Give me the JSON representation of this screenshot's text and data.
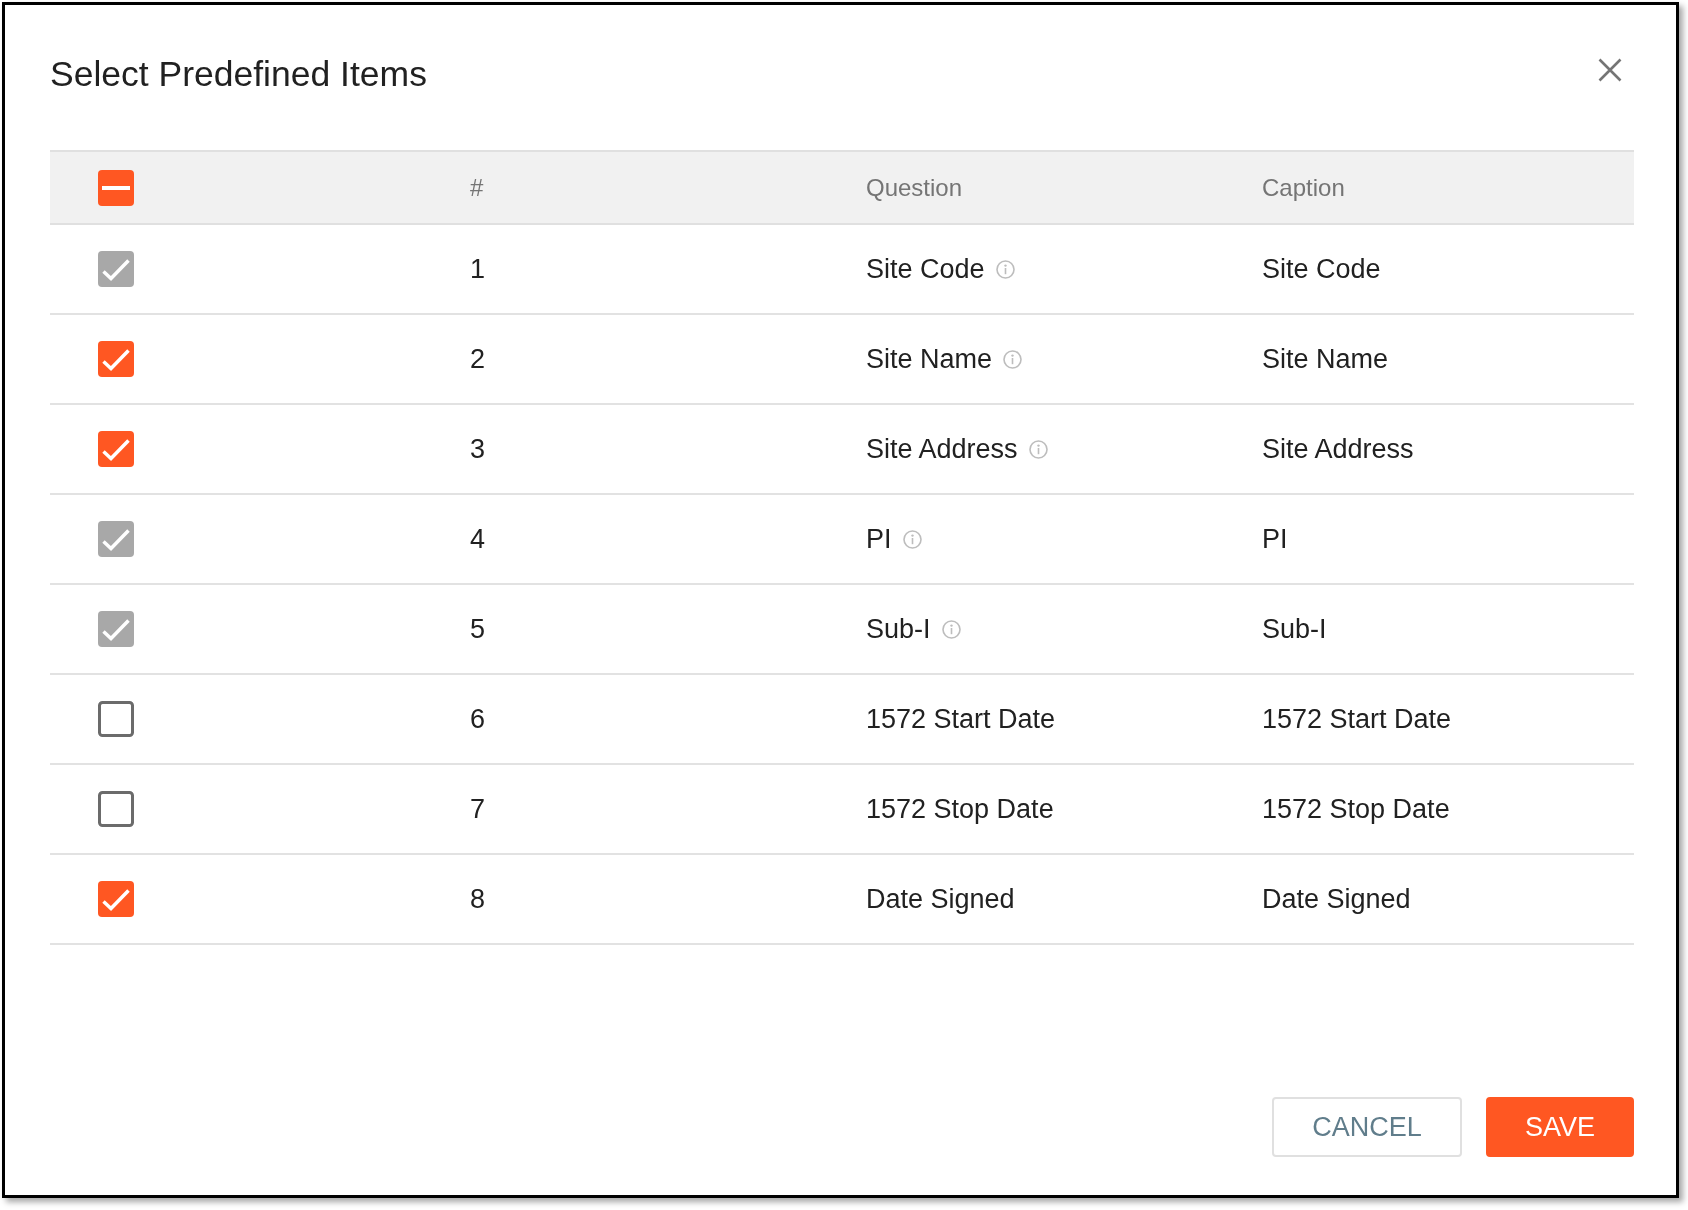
{
  "dialog": {
    "title": "Select Predefined Items"
  },
  "table": {
    "columns": [
      "#",
      "Question",
      "Caption"
    ],
    "select_all": {
      "indeterminate": true
    },
    "rows": [
      {
        "checked": true,
        "disabled": true,
        "number": "1",
        "question": "Site Code",
        "info": true,
        "caption": "Site Code"
      },
      {
        "checked": true,
        "disabled": false,
        "number": "2",
        "question": "Site Name",
        "info": true,
        "caption": "Site Name"
      },
      {
        "checked": true,
        "disabled": false,
        "number": "3",
        "question": "Site Address",
        "info": true,
        "caption": "Site Address"
      },
      {
        "checked": true,
        "disabled": true,
        "number": "4",
        "question": "PI",
        "info": true,
        "caption": "PI"
      },
      {
        "checked": true,
        "disabled": true,
        "number": "5",
        "question": "Sub-I",
        "info": true,
        "caption": "Sub-I"
      },
      {
        "checked": false,
        "disabled": false,
        "number": "6",
        "question": "1572 Start Date",
        "info": false,
        "caption": "1572 Start Date"
      },
      {
        "checked": false,
        "disabled": false,
        "number": "7",
        "question": "1572 Stop Date",
        "info": false,
        "caption": "1572 Stop Date"
      },
      {
        "checked": true,
        "disabled": false,
        "number": "8",
        "question": "Date Signed",
        "info": false,
        "caption": "Date Signed"
      }
    ]
  },
  "buttons": [
    {
      "label": "CANCEL",
      "kind": "secondary"
    },
    {
      "label": "SAVE",
      "kind": "primary"
    }
  ]
}
